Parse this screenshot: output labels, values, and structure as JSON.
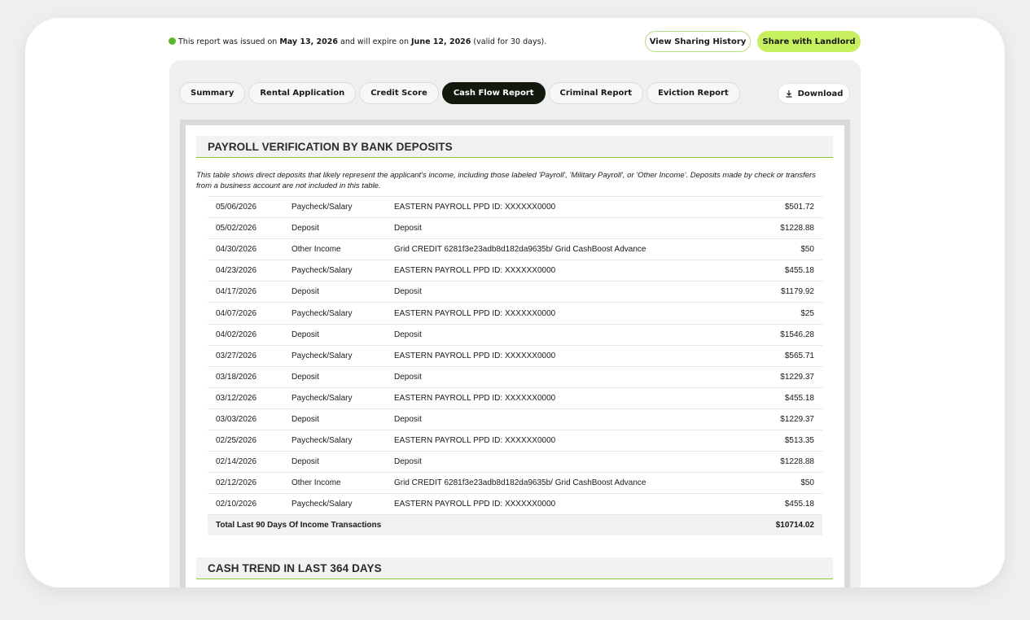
{
  "notice": {
    "prefix": "This report was issued on ",
    "issued": "May 13, 2026",
    "middle": " and will expire on ",
    "expires": "June 12, 2026",
    "suffix": " (valid for 30 days)."
  },
  "buttons": {
    "sharing_history": "View Sharing History",
    "share_landlord": "Share with Landlord",
    "download": "Download"
  },
  "tabs": [
    {
      "label": "Summary",
      "active": false
    },
    {
      "label": "Rental Application",
      "active": false
    },
    {
      "label": "Credit Score",
      "active": false
    },
    {
      "label": "Cash Flow Report",
      "active": true
    },
    {
      "label": "Criminal Report",
      "active": false
    },
    {
      "label": "Eviction Report",
      "active": false
    }
  ],
  "payroll": {
    "title": "PAYROLL VERIFICATION BY BANK DEPOSITS",
    "description": "This table shows direct deposits that likely represent the applicant's income, including those labeled 'Payroll', 'Military Payroll', or 'Other Income'. Deposits made by check or transfers from a business account are not included in this table.",
    "rows": [
      {
        "date": "05/06/2026",
        "type": "Paycheck/Salary",
        "description": "EASTERN PAYROLL PPD ID: XXXXXX0000",
        "amount": "$501.72"
      },
      {
        "date": "05/02/2026",
        "type": "Deposit",
        "description": "Deposit",
        "amount": "$1228.88"
      },
      {
        "date": "04/30/2026",
        "type": "Other Income",
        "description": "Grid CREDIT 6281f3e23adb8d182da9635b/ Grid CashBoost Advance",
        "amount": "$50"
      },
      {
        "date": "04/23/2026",
        "type": "Paycheck/Salary",
        "description": "EASTERN PAYROLL PPD ID: XXXXXX0000",
        "amount": "$455.18"
      },
      {
        "date": "04/17/2026",
        "type": "Deposit",
        "description": "Deposit",
        "amount": "$1179.92"
      },
      {
        "date": "04/07/2026",
        "type": "Paycheck/Salary",
        "description": "EASTERN PAYROLL PPD ID: XXXXXX0000",
        "amount": "$25"
      },
      {
        "date": "04/02/2026",
        "type": "Deposit",
        "description": "Deposit",
        "amount": "$1546.28"
      },
      {
        "date": "03/27/2026",
        "type": "Paycheck/Salary",
        "description": "EASTERN PAYROLL PPD ID: XXXXXX0000",
        "amount": "$565.71"
      },
      {
        "date": "03/18/2026",
        "type": "Deposit",
        "description": "Deposit",
        "amount": "$1229.37"
      },
      {
        "date": "03/12/2026",
        "type": "Paycheck/Salary",
        "description": "EASTERN PAYROLL PPD ID: XXXXXX0000",
        "amount": "$455.18"
      },
      {
        "date": "03/03/2026",
        "type": "Deposit",
        "description": "Deposit",
        "amount": "$1229.37"
      },
      {
        "date": "02/25/2026",
        "type": "Paycheck/Salary",
        "description": "EASTERN PAYROLL PPD ID: XXXXXX0000",
        "amount": "$513.35"
      },
      {
        "date": "02/14/2026",
        "type": "Deposit",
        "description": "Deposit",
        "amount": "$1228.88"
      },
      {
        "date": "02/12/2026",
        "type": "Other Income",
        "description": "Grid CREDIT 6281f3e23adb8d182da9635b/ Grid CashBoost Advance",
        "amount": "$50"
      },
      {
        "date": "02/10/2026",
        "type": "Paycheck/Salary",
        "description": "EASTERN PAYROLL PPD ID: XXXXXX0000",
        "amount": "$455.18"
      }
    ],
    "total_label": "Total Last 90 Days Of Income Transactions",
    "total_amount": "$10714.02"
  },
  "cash_trend": {
    "title": "CASH TREND IN LAST 364 DAYS"
  },
  "icons": {
    "notice": "check-circle-icon",
    "download": "download-icon"
  },
  "colors": {
    "accent": "#c6f05e",
    "rule": "#8fc63f",
    "active_tab": "#121a0e",
    "notice_dot": "#5cb531"
  }
}
